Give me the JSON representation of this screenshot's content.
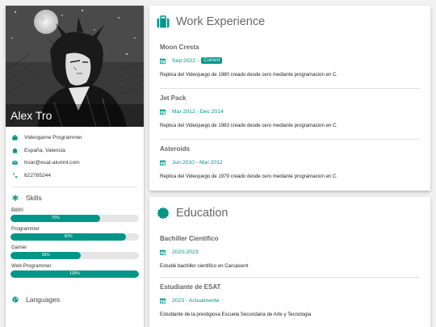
{
  "profile": {
    "name": "Alex Tro",
    "contact": [
      {
        "icon": "briefcase-icon",
        "text": "Videogame Programmer"
      },
      {
        "icon": "home-icon",
        "text": "España, Valencia"
      },
      {
        "icon": "envelope-icon",
        "text": "troar@esat-alumni.com"
      },
      {
        "icon": "phone-icon",
        "text": "622785244"
      }
    ]
  },
  "skills": {
    "heading": "Skills",
    "items": [
      {
        "label": "B800",
        "percent": "70%",
        "value": 70
      },
      {
        "label": "Programmer",
        "percent": "90%",
        "value": 90
      },
      {
        "label": "Gamer",
        "percent": "55%",
        "value": 55
      },
      {
        "label": "Web Programmer",
        "percent": "100%",
        "value": 100
      }
    ]
  },
  "languages": {
    "heading": "Languages"
  },
  "work": {
    "title": "Work Experience",
    "entries": [
      {
        "title": "Moon Cresta",
        "date": "Sep 2022 -",
        "badge": "Current",
        "desc": "Replica del Videojuego de 1980 creado desde cero mediante programacion en C."
      },
      {
        "title": "Jet Pack",
        "date": "Mar 2012 - Dec 2014",
        "desc": "Replica del Videojuego de 1983 creado desde cero mediante programacion en C."
      },
      {
        "title": "Asteroids",
        "date": "Jun 2010 - Mar 2012",
        "desc": "Replica del Videojuego de 1979 creado desde cero mediante programacion en C."
      }
    ]
  },
  "education": {
    "title": "Education",
    "entries": [
      {
        "title": "Bachiller Cientifico",
        "date": "2020-2023",
        "desc": "Estudié bachiller cientifico en Carcaixent"
      },
      {
        "title": "Estudiante de ESAT",
        "date": "2023 - Actualmente",
        "desc": "Estudiante de la prestigiosa Escuela Secundaria de Arte y Tecnologia"
      }
    ]
  },
  "colors": {
    "accent": "#009688",
    "background": "#f1f1f1"
  }
}
